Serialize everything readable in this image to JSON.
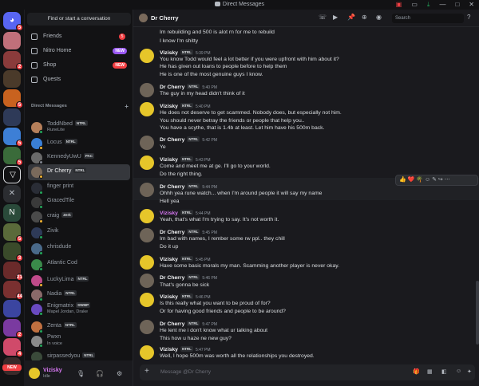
{
  "window": {
    "title": "Direct Messages"
  },
  "guilds": {
    "home_badge": "5",
    "badges": [
      "2",
      "5",
      "5",
      "5",
      "5",
      "3",
      "21",
      "44",
      "2",
      "4",
      "2"
    ],
    "new_label": "NEW"
  },
  "sidebar": {
    "search_button": "Find or start a conversation",
    "nav": [
      {
        "label": "Friends",
        "badge": "5"
      },
      {
        "label": "Nitro Home",
        "pill": "NEW"
      },
      {
        "label": "Shop",
        "pill": "NEW"
      },
      {
        "label": "Quests"
      }
    ],
    "dm_header": "Direct Messages",
    "dms": [
      {
        "name": "ToddNbed",
        "tag": "NTRL",
        "sub": "RuneLite"
      },
      {
        "name": "Locus",
        "tag": "NTRL"
      },
      {
        "name": "KennedyUwU",
        "tag": "PAC"
      },
      {
        "name": "Dr Cherry",
        "tag": "NTRL"
      },
      {
        "name": "finger print"
      },
      {
        "name": "GracedTile"
      },
      {
        "name": "craig",
        "tag": "Zerk"
      },
      {
        "name": "Zivik"
      },
      {
        "name": "chrisdude"
      },
      {
        "name": "Atlantic Cod"
      },
      {
        "name": "LuckyLima",
        "tag": "NTRL"
      },
      {
        "name": "Nadia",
        "tag": "NTRL"
      },
      {
        "name": "Enigmatrix",
        "tag": "SWMP",
        "sub": "Mapel Jordan, Drake"
      },
      {
        "name": "Zenta",
        "tag": "NTRL"
      },
      {
        "name": "Pwxn",
        "sub": "In voice"
      },
      {
        "name": "sirpassedyou",
        "tag": "NTRL"
      },
      {
        "name": "Trioxide"
      }
    ]
  },
  "user": {
    "name": "Vizisky",
    "status": "Idle"
  },
  "header": {
    "name": "Dr Cherry",
    "search_placeholder": "Search"
  },
  "messages": {
    "lines": [
      "Im rebuilding and 500 is alot rn for me to rebuild",
      "I know I'm shitty",
      "You know Todd would feel a lot better if you were upfront with him about it?",
      "He has given out loans to people before to help them",
      "He is one of the most genuine guys I know.",
      "The guy in my head didn't think of it",
      "He does not deserve to get scammed. Nobody does, but especially not him.",
      "You should never betray the friends or people that help you..",
      "You have a scythe, that is 1.4b at least. Let him have his 500m back.",
      "Ye",
      "Come and meet me at ge. I'll go to your world.",
      "Do the right thing.",
      "Ohhh yea rune watch... when I'm around people it will say my name",
      "Hell yea",
      "Yeah, that's what I'm trying to say. It's not worth it.",
      "Im bad with names, I rember some rw ppl.. they chill",
      "Do it up",
      "Have some basic morals my man. Scamming another player is never okay.",
      "That's gonna be sick",
      "Is this really what you want to be proud of for?",
      "Or for having good friends and people to be around?",
      "He lent me i don't know what ur talking about",
      "This how u haze ne new guy?",
      "Well, I hope 500m was worth all the relationships you destroyed."
    ],
    "names": {
      "viz": "Vizisky",
      "doc": "Dr Cherry",
      "tag": "NTRL"
    },
    "times": [
      "5:39 PM",
      "5:40 PM",
      "5:40 PM",
      "5:42 PM",
      "5:43 PM",
      "5:44 PM",
      "5:44 PM",
      "5:45 PM",
      "5:45 PM",
      "5:46 PM",
      "5:46 PM",
      "5:47 PM",
      "5:47 PM"
    ],
    "hover_reactions": "👍 ❤️ 🌴"
  },
  "composer": {
    "placeholder": "Message @Dr Cherry"
  },
  "colors": {
    "accent": "#5865f2",
    "danger": "#f23f43",
    "online": "#23a55a",
    "username": "#d978f5"
  }
}
